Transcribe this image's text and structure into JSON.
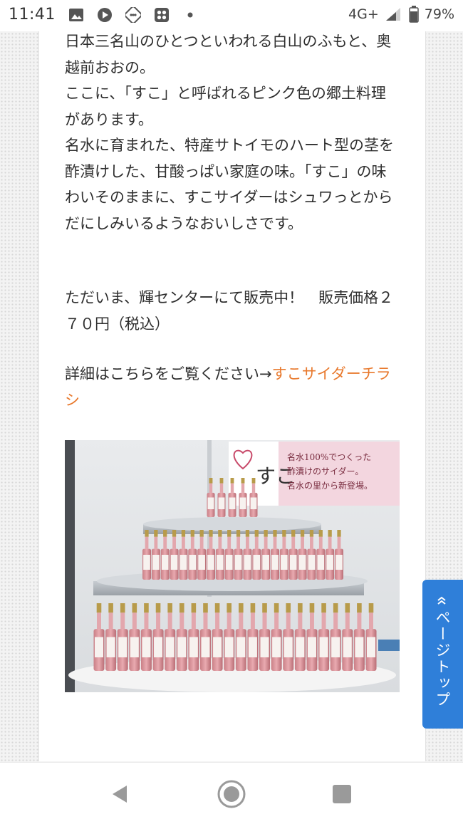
{
  "status_bar": {
    "time": "11:41",
    "network": "4G+",
    "battery": "79%",
    "left_icons": [
      "image-icon",
      "play-icon",
      "dice-icon",
      "grid-app-icon",
      "dot-icon"
    ],
    "right_icons": [
      "signal-icon",
      "battery-icon"
    ]
  },
  "article": {
    "paragraph1": "日本三名山のひとつといわれる白山のふもと、奥越前おおの。\nここに、「すこ」と呼ばれるピンク色の郷土料理があります。\n名水に育まれた、特産サトイモのハート型の茎を酢漬けした、甘酸っぱい家庭の味。「すこ」の味わいそのままに、すこサイダーはシュワっとからだにしみいるようなおいしさです。",
    "paragraph2": "ただいま、輝センターにて販売中！　販売価格２７０円（税込）",
    "paragraph3_prefix": "詳細はこちらをご覧ください→",
    "paragraph3_link": "すこサイダーチラシ"
  },
  "photo": {
    "banner_logo_text": "すこ",
    "banner_lines": [
      "名水100%でつくった",
      "酢漬けのサイダー。",
      "名水の里から新登場。"
    ]
  },
  "pagetop_button": {
    "label": "ページトップ"
  },
  "nav": {
    "back_icon": "back-triangle-icon",
    "home_icon": "home-circle-icon",
    "recents_icon": "recents-square-icon"
  },
  "colors": {
    "link": "#e8792d",
    "pagetop_bg": "#2f7fd9",
    "text": "#2f2f2f"
  }
}
